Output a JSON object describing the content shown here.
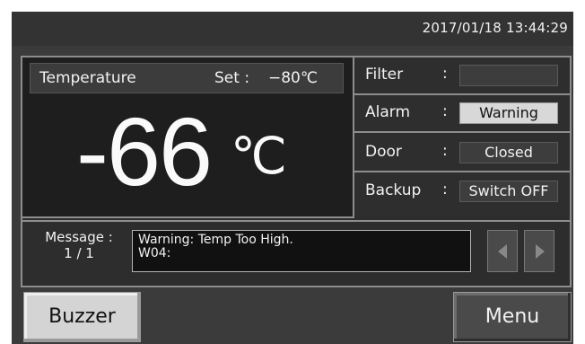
{
  "header": {
    "datetime": "2017/01/18  13:44:29"
  },
  "temperature": {
    "label": "Temperature",
    "set_label": "Set :",
    "set_value": "−80℃",
    "current_value": "-66",
    "unit": "℃"
  },
  "status": {
    "filter": {
      "label": "Filter",
      "colon": ":",
      "value": ""
    },
    "alarm": {
      "label": "Alarm",
      "colon": ":",
      "value": "Warning"
    },
    "door": {
      "label": "Door",
      "colon": ":",
      "value": "Closed"
    },
    "backup": {
      "label": "Backup",
      "colon": ":",
      "value": "Switch OFF"
    }
  },
  "message": {
    "label": "Message :",
    "page": "1 / 1",
    "line1": "Warning: Temp Too High.",
    "line2": "W04:"
  },
  "buttons": {
    "buzzer": "Buzzer",
    "menu": "Menu"
  },
  "icons": {
    "prev": "triangle-left-icon",
    "next": "triangle-right-icon"
  }
}
